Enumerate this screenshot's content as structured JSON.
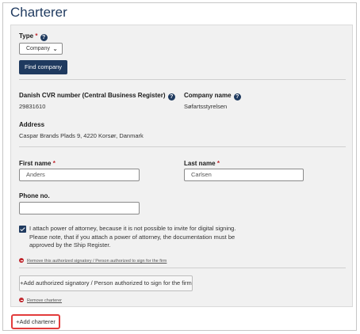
{
  "section": {
    "title": "Charterer"
  },
  "type_field": {
    "label": "Type",
    "required_mark": "*",
    "selected": "Company"
  },
  "find_company_label": "Find company",
  "cvr": {
    "label": "Danish CVR number (Central Business Register)",
    "value": "29831610"
  },
  "company": {
    "label": "Company name",
    "value": "Søfartsstyrelsen"
  },
  "address": {
    "label": "Address",
    "value": "Caspar Brands Plads 9, 4220 Korsør, Danmark"
  },
  "first_name": {
    "label": "First name",
    "required_mark": "*",
    "value": "Anders"
  },
  "last_name": {
    "label": "Last name",
    "required_mark": "*",
    "value": "Carlsen"
  },
  "phone": {
    "label": "Phone no.",
    "value": ""
  },
  "attach_poa": {
    "checked": true,
    "text": "I attach power of attorney, because it is not possible to invite for digital signing. Please note, that if you attach a power of attorney, the documentation must be approved by the Ship Register."
  },
  "remove_signatory_label": "Remove this authorized signatory / Person authorized to sign for the firm",
  "add_signatory_label": "+Add authorized signatory / Person authorized to sign for the firm",
  "remove_charterer_label": "Remove charterer",
  "add_charterer_label": "+Add charterer",
  "colors": {
    "primary": "#1f3a5f",
    "required": "#c0262d",
    "highlight": "#e23c3c"
  }
}
